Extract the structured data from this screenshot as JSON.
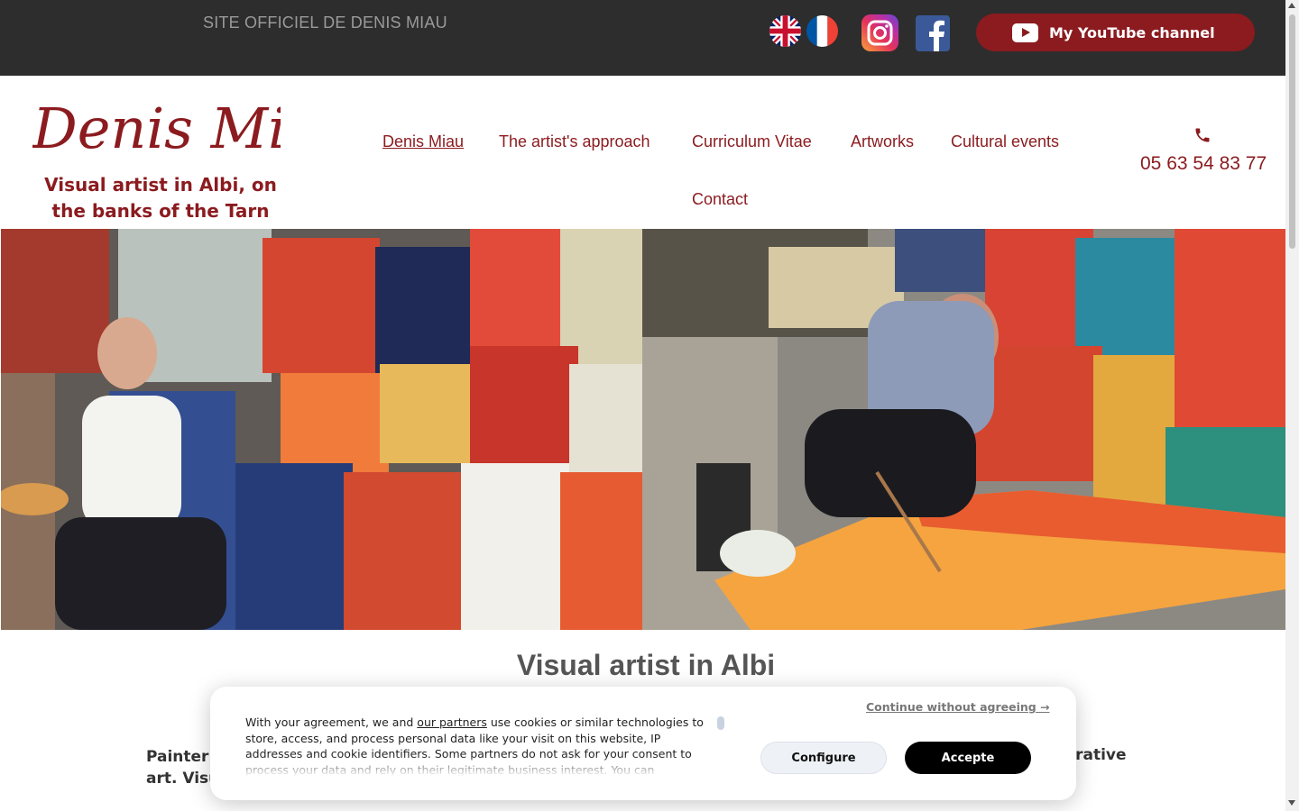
{
  "topbar": {
    "site_label": "SITE OFFICIEL DE DENIS MIAU",
    "youtube_label": "My YouTube channel",
    "icons": [
      "uk-flag-icon",
      "fr-flag-icon",
      "instagram-icon",
      "facebook-icon",
      "youtube-icon"
    ]
  },
  "header": {
    "logo_text": "Denis Miau",
    "tagline": "Visual artist in Albi, on the banks of the Tarn",
    "phone": "05 63 54 83 77"
  },
  "nav": {
    "items": [
      {
        "label": "Denis Miau",
        "active": true
      },
      {
        "label": "The artist's approach"
      },
      {
        "label": "Curriculum Vitae"
      },
      {
        "label": "Artworks"
      },
      {
        "label": "Cultural events"
      },
      {
        "label": "Contact"
      }
    ]
  },
  "main": {
    "section_title": "Visual artist in Albi",
    "body_left_line1": "Painter",
    "body_left_line2": "art. Visu",
    "body_right": "urative"
  },
  "cookie": {
    "text_before_link": "With your agreement, we and ",
    "link_text": "our partners",
    "text_after_link": " use cookies or similar technologies to store, access, and process personal data like your visit on this website, IP addresses and cookie identifiers. Some partners do not ask for your consent to process your data and rely on their legitimate business interest. You can",
    "continue_label": "Continue without agreeing →",
    "configure_label": "Configure",
    "accept_label": "Accepte"
  },
  "colors": {
    "brand": "#8b1b1f",
    "topbar": "#2d2d2d"
  }
}
